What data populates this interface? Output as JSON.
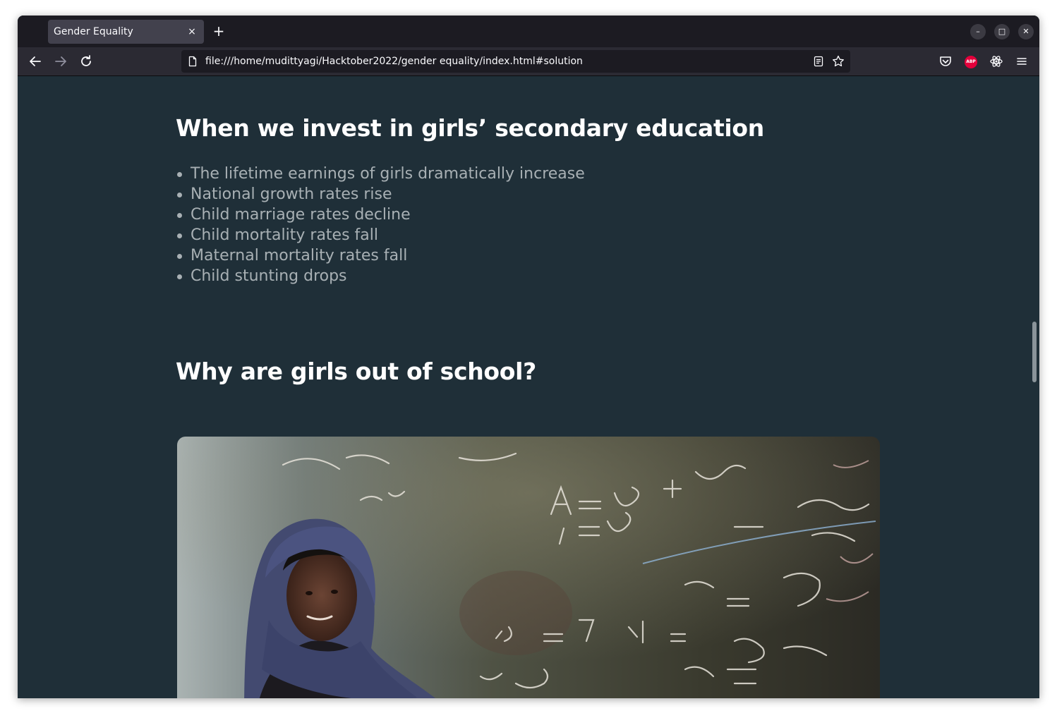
{
  "browser": {
    "tab_title": "Gender Equality",
    "tab_close": "×",
    "new_tab": "+",
    "url": "file:///home/mudittyagi/Hacktober2022/gender equality/index.html#solution",
    "minimize": "–",
    "maximize": "□",
    "close": "✕",
    "icons": [
      "back-icon",
      "forward-icon",
      "reload-icon",
      "page-icon",
      "reader-view-icon",
      "bookmark-star-icon",
      "pocket-icon",
      "adblock-plus-icon",
      "react-devtools-icon",
      "menu-icon"
    ],
    "abp_label": "ABP"
  },
  "page": {
    "section1_heading": "When we invest in girls’ secondary education",
    "benefits": [
      "The lifetime earnings of girls dramatically increase",
      "National growth rates rise",
      "Child marriage rates decline",
      "Child mortality rates fall",
      "Maternal mortality rates fall",
      "Child stunting drops"
    ],
    "section2_heading": "Why are girls out of school?",
    "colors": {
      "background": "#1f2f38",
      "heading": "#ffffff",
      "body_text": "#a8b0b4"
    }
  }
}
